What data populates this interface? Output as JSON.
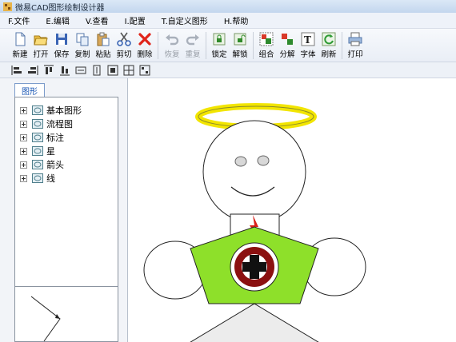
{
  "window": {
    "title": "微易CAD图形绘制设计器"
  },
  "menu": {
    "items": [
      "F.文件",
      "E.编辑",
      "V.查看",
      "I.配置",
      "T.自定义图形",
      "H.帮助"
    ]
  },
  "toolbar": {
    "new": "新建",
    "open": "打开",
    "save": "保存",
    "copy": "复制",
    "paste": "粘贴",
    "cut": "剪切",
    "delete": "删除",
    "undo": "恢复",
    "redo": "重复",
    "lock": "锁定",
    "unlock": "解锁",
    "group": "组合",
    "ungroup": "分解",
    "font": "字体",
    "refresh": "刷新",
    "print": "打印"
  },
  "panel": {
    "tab": "图形",
    "tree": [
      "基本图形",
      "流程图",
      "标注",
      "星",
      "箭头",
      "线"
    ]
  },
  "colors": {
    "halo": "#f2e500",
    "body": "#8ee02a",
    "tie": "#d9201a",
    "badge_ring": "#8b1010"
  }
}
